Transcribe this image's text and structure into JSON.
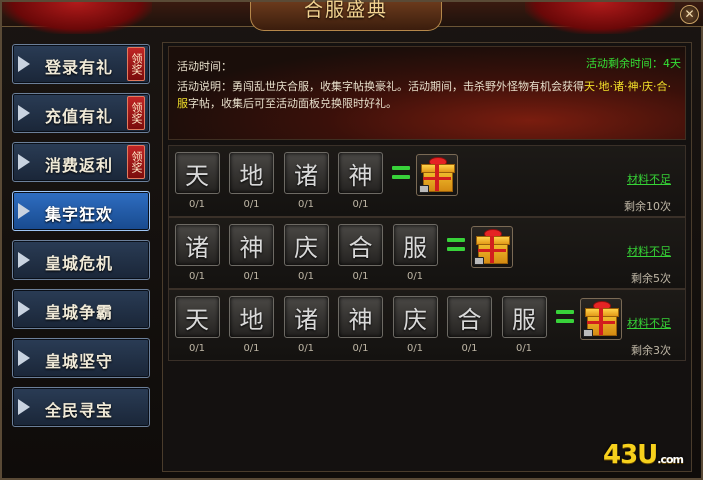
{
  "window": {
    "title": "合服盛典",
    "close_symbol": "✕"
  },
  "sidebar": {
    "items": [
      {
        "label": "登录有礼",
        "tag": "领奖"
      },
      {
        "label": "充值有礼",
        "tag": "领奖"
      },
      {
        "label": "消费返利",
        "tag": "领奖"
      },
      {
        "label": "集字狂欢",
        "tag": ""
      },
      {
        "label": "皇城危机",
        "tag": ""
      },
      {
        "label": "皇城争霸",
        "tag": ""
      },
      {
        "label": "皇城坚守",
        "tag": ""
      },
      {
        "label": "全民寻宝",
        "tag": ""
      }
    ],
    "active_index": 3
  },
  "banner": {
    "time_label": "活动时间：",
    "countdown": "活动剩余时间：4天",
    "desc_prefix": "活动说明：勇闯乱世庆合服，收集字帖换豪礼。活动期间，击杀野外怪物有机会获得",
    "desc_chars": "天·地·诸·神·庆·合·服",
    "desc_suffix": "字帖，收集后可至活动面板兑换限时好礼。"
  },
  "rows": [
    {
      "chars": [
        "天",
        "地",
        "诸",
        "神"
      ],
      "counts": [
        "0/1",
        "0/1",
        "0/1",
        "0/1"
      ],
      "status": "材料不足",
      "remaining": "剩余10次"
    },
    {
      "chars": [
        "诸",
        "神",
        "庆",
        "合",
        "服"
      ],
      "counts": [
        "0/1",
        "0/1",
        "0/1",
        "0/1",
        "0/1"
      ],
      "status": "材料不足",
      "remaining": "剩余5次"
    },
    {
      "chars": [
        "天",
        "地",
        "诸",
        "神",
        "庆",
        "合",
        "服"
      ],
      "counts": [
        "0/1",
        "0/1",
        "0/1",
        "0/1",
        "0/1",
        "0/1",
        "0/1"
      ],
      "status": "材料不足",
      "remaining": "剩余3次"
    }
  ],
  "watermark": {
    "main": "43U",
    "suffix": ".com"
  },
  "colors": {
    "accent_green": "#36d336",
    "highlight_yellow": "#f2e02a",
    "active_tab": "#2f6ec2"
  }
}
